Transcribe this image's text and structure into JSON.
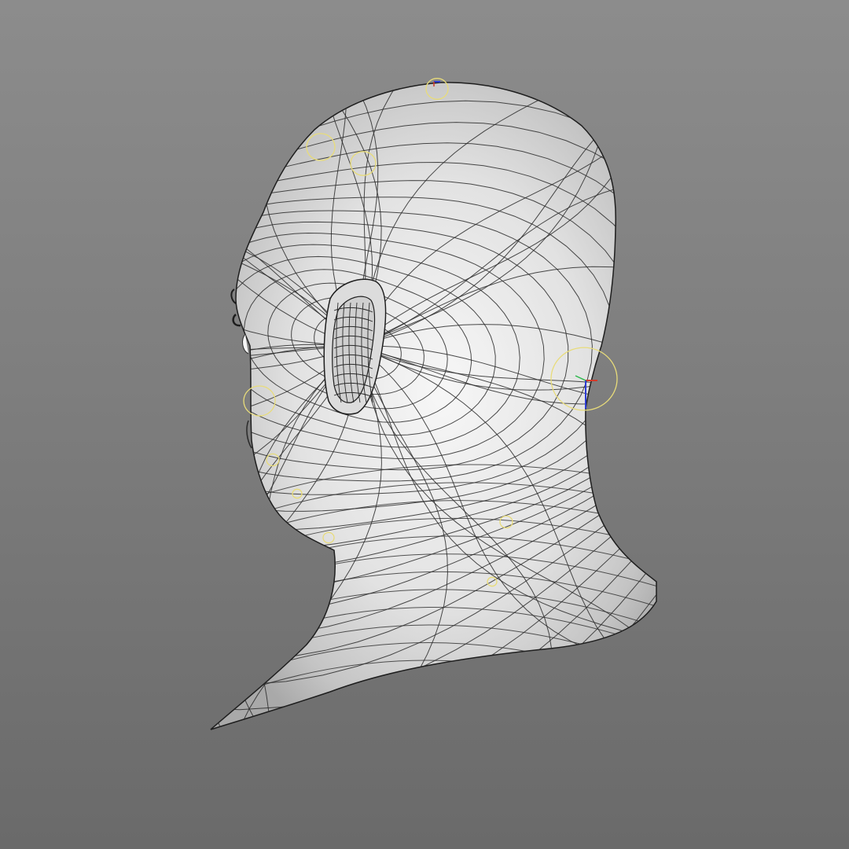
{
  "viewport": {
    "colors": {
      "background_top": "#8c8c8c",
      "background_bottom": "#6a6a6a",
      "mesh_surface": "#e9e9e9",
      "mesh_shadow": "#9c9c9c",
      "wire": "#2a2a2a",
      "rig_control": "#e8dc7a",
      "axis_red": "#d23a2a",
      "axis_blue": "#2a3ad2",
      "axis_green": "#2ab84a"
    },
    "shading_mode": "wireframe-on-shaded",
    "object": "head-mesh"
  }
}
